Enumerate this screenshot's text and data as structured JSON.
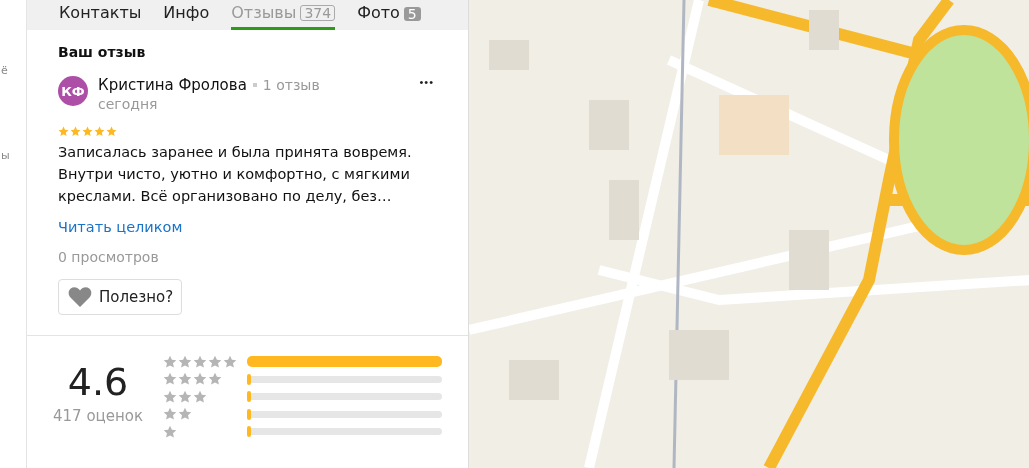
{
  "side_strip": {
    "texts": [
      "ё",
      "ы"
    ]
  },
  "tabs": [
    {
      "label": "Контакты",
      "selected": false
    },
    {
      "label": "Инфо",
      "selected": false
    },
    {
      "label": "Отзывы",
      "count": "374",
      "selected": true
    },
    {
      "label": "Фото",
      "count": "5",
      "selected": false
    }
  ],
  "my_review": {
    "heading": "Ваш отзыв",
    "avatar_initials": "КФ",
    "author": "Кристина Фролова",
    "author_reviews": "1 отзыв",
    "date": "сегодня",
    "menu": "•••",
    "stars": 5,
    "text": "Записалась заранее и была принята вовремя. Внутри чисто, уютно и комфортно, с мягкими креслами. Всё организовано по делу, без…",
    "read_more": "Читать целиком",
    "views": "0 просмотров",
    "helpful_button": "Полезно?"
  },
  "rating": {
    "score": "4.6",
    "count": "417 оценок",
    "distribution": [
      {
        "level": 1.0
      },
      {
        "level": 0.01
      },
      {
        "level": 0.02
      },
      {
        "level": 0.02
      },
      {
        "level": 0.02
      }
    ]
  }
}
